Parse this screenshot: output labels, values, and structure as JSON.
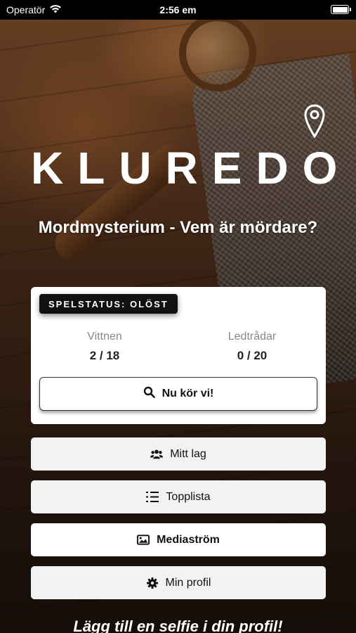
{
  "status_bar": {
    "carrier": "Operatör",
    "time": "2:56 em"
  },
  "app": {
    "logo": "KLUREDO",
    "game_title": "Mordmysterium - Vem är mördare?"
  },
  "game_card": {
    "status": "SPELSTATUS: OLÖST",
    "witnesses_label": "Vittnen",
    "witnesses_value": "2 / 18",
    "clues_label": "Ledtrådar",
    "clues_value": "0 / 20",
    "start_button": "Nu kör vi!"
  },
  "menu": {
    "team": "Mitt lag",
    "leaderboard": "Topplista",
    "media": "Mediaström",
    "profile": "Min profil"
  },
  "footer": {
    "prompt": "Lägg till en selfie i din profil!"
  },
  "icons": {
    "wifi": "wifi-icon",
    "battery": "battery-icon",
    "location": "location-pin-icon",
    "search": "search-icon",
    "team": "users-icon",
    "leaderboard": "list-icon",
    "media": "image-icon",
    "profile": "gear-icon"
  }
}
